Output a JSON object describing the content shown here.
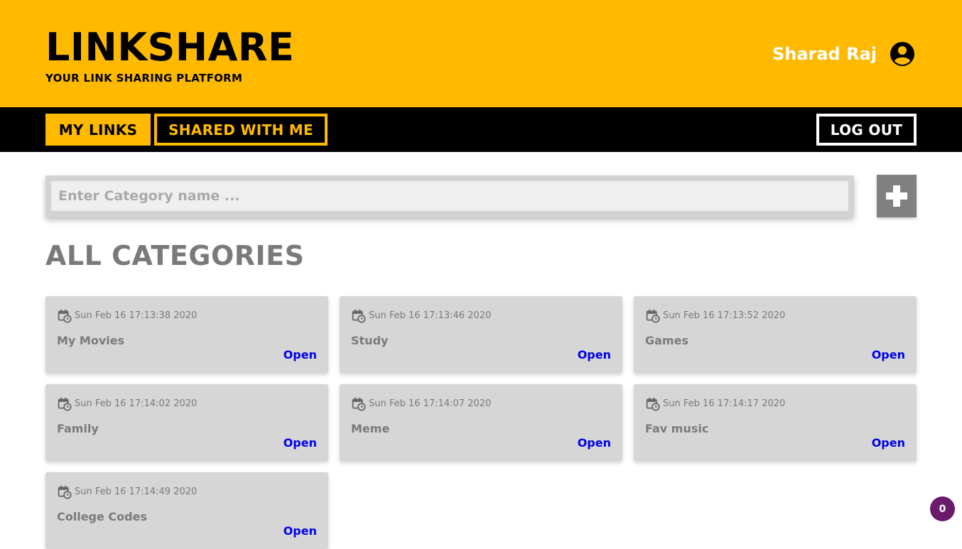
{
  "header": {
    "title": "LINKSHARE",
    "tagline": "YOUR LINK SHARING PLATFORM",
    "user_name": "Sharad Raj"
  },
  "nav": {
    "my_links": "MY LINKS",
    "shared_with_me": "SHARED WITH ME",
    "log_out": "LOG OUT"
  },
  "search": {
    "placeholder": "Enter Category name ..."
  },
  "section_title": "ALL CATEGORIES",
  "categories": [
    {
      "date": "Sun Feb 16 17:13:38 2020",
      "name": "My Movies",
      "action": "Open"
    },
    {
      "date": "Sun Feb 16 17:13:46 2020",
      "name": "Study",
      "action": "Open"
    },
    {
      "date": "Sun Feb 16 17:13:52 2020",
      "name": "Games",
      "action": "Open"
    },
    {
      "date": "Sun Feb 16 17:14:02 2020",
      "name": "Family",
      "action": "Open"
    },
    {
      "date": "Sun Feb 16 17:14:07 2020",
      "name": "Meme",
      "action": "Open"
    },
    {
      "date": "Sun Feb 16 17:14:17 2020",
      "name": "Fav music",
      "action": "Open"
    },
    {
      "date": "Sun Feb 16 17:14:49 2020",
      "name": "College Codes",
      "action": "Open"
    }
  ],
  "badge_count": "0",
  "colors": {
    "brand": "#ffba00",
    "nav_bg": "#000000",
    "card_bg": "#d6d6d6",
    "link": "#0000ee",
    "badge": "#6a1b6a"
  },
  "icons": {
    "user": "account-circle-icon",
    "add": "plus-icon",
    "date": "calendar-clock-icon"
  }
}
